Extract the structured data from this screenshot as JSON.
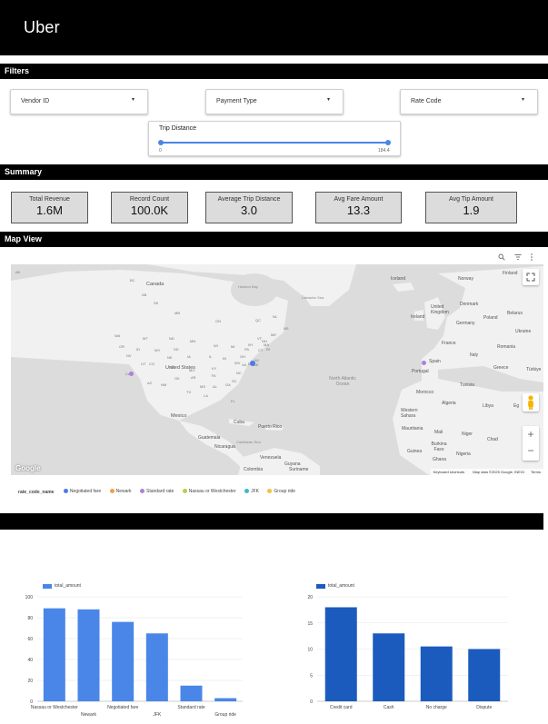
{
  "header": {
    "logo": "Uber"
  },
  "filters": {
    "title": "Filters",
    "dropdowns": [
      {
        "label": "Vendor ID"
      },
      {
        "label": "Payment Type"
      },
      {
        "label": "Rate Code"
      }
    ],
    "trip_distance": {
      "label": "Trip Distance",
      "min": "0",
      "max": "184.4"
    }
  },
  "summary": {
    "title": "Summary",
    "kpis": [
      {
        "title": "Total Revenue",
        "value": "1.6M"
      },
      {
        "title": "Record Count",
        "value": "100.0K"
      },
      {
        "title": "Average Trip Distance",
        "value": "3.0"
      },
      {
        "title": "Avg Fare Amount",
        "value": "13.3"
      },
      {
        "title": "Avg Tip Amount",
        "value": "1.9"
      }
    ]
  },
  "map": {
    "title": "Map View",
    "watermark": "Google",
    "attribution": {
      "shortcuts": "Keyboard shortcuts",
      "data": "Map data ©2025 Google, INEGI",
      "terms": "Terms"
    },
    "legend_title": "rate_code_name",
    "legend": [
      {
        "name": "Negotiated fare",
        "color": "#4f79e8"
      },
      {
        "name": "Newark",
        "color": "#f0a04b"
      },
      {
        "name": "Standard rate",
        "color": "#b07ee0"
      },
      {
        "name": "Nassau or Westchester",
        "color": "#b5cf4a"
      },
      {
        "name": "JFK",
        "color": "#3fb8c9"
      },
      {
        "name": "Group ride",
        "color": "#f2c23e"
      }
    ],
    "places": {
      "canada": "Canada",
      "united_states": "United States",
      "mexico": "Mexico",
      "cuba": "Cuba",
      "puerto_rico": "Puerto Rico",
      "guatemala": "Guatemala",
      "nicaragua": "Nicaragua",
      "venezuela": "Venezuela",
      "colombia": "Colombia",
      "guyana": "Guyana",
      "suriname": "Suriname",
      "hudson_bay": "Hudson Bay",
      "labrador_sea": "Labrador Sea",
      "north_atlantic_ocean": "North Atlantic Ocean",
      "caribbean_sea": "Caribbean Sea",
      "iceland": "Iceland",
      "united_kingdom": "United Kingdom",
      "ireland": "Ireland",
      "norway": "Norway",
      "finland": "Finland",
      "denmark": "Denmark",
      "germany": "Germany",
      "poland": "Poland",
      "belarus": "Belarus",
      "ukraine": "Ukraine",
      "france": "France",
      "romania": "Romania",
      "spain": "Spain",
      "portugal": "Portugal",
      "italy": "Italy",
      "greece": "Greece",
      "turkiye": "Türkiye",
      "morocco": "Morocco",
      "tunisia": "Tunisia",
      "algeria": "Algeria",
      "libya": "Libya",
      "egypt": "Eg",
      "western_sahara": "Western Sahara",
      "mauritania": "Mauritania",
      "mali": "Mali",
      "niger": "Niger",
      "chad": "Chad",
      "burkina_faso": "Burkina Faso",
      "nigeria": "Nigeria",
      "guinea": "Guinea",
      "ghana": "Ghana",
      "states": [
        "AK",
        "BC",
        "AB",
        "SK",
        "MB",
        "ON",
        "QC",
        "NL",
        "NS",
        "WA",
        "MT",
        "ND",
        "MN",
        "OR",
        "ID",
        "WY",
        "SD",
        "WI",
        "MI",
        "NV",
        "NE",
        "IA",
        "IL",
        "IN",
        "OH",
        "PA",
        "NY",
        "UT",
        "CO",
        "KS",
        "MO",
        "KY",
        "WV",
        "VA",
        "CA",
        "AZ",
        "NM",
        "OK",
        "AR",
        "TN",
        "NC",
        "SC",
        "TX",
        "LA",
        "MS",
        "AL",
        "GA",
        "FL",
        "ME",
        "VT",
        "NH",
        "MA",
        "CT",
        "RI",
        "NJ",
        "DE",
        "MD"
      ]
    }
  },
  "colors": {
    "chart1": "#4a86e8",
    "chart2": "#1c5bbe",
    "header": "#000000",
    "kpi_bg": "#dcdcdc"
  },
  "chart_data": [
    {
      "type": "bar",
      "series": [
        {
          "name": "total_amount",
          "values": [
            89,
            88,
            76,
            65,
            15,
            3
          ]
        }
      ],
      "categories": [
        "Nassau or Westchester",
        "Newark",
        "Negotiated fare",
        "JFK",
        "Standard rate",
        "Group ride"
      ],
      "ylim": [
        0,
        100
      ],
      "yticks": [
        "0",
        "20",
        "40",
        "60",
        "80",
        "100"
      ],
      "grid": true,
      "legend": "top-left"
    },
    {
      "type": "bar",
      "series": [
        {
          "name": "total_amount",
          "values": [
            18,
            13,
            10.5,
            10
          ]
        }
      ],
      "categories": [
        "Credit card",
        "Cash",
        "No charge",
        "Dispute"
      ],
      "ylim": [
        0,
        20
      ],
      "yticks": [
        "0",
        "5",
        "10",
        "15",
        "20"
      ],
      "grid": true,
      "legend": "top-left"
    }
  ]
}
